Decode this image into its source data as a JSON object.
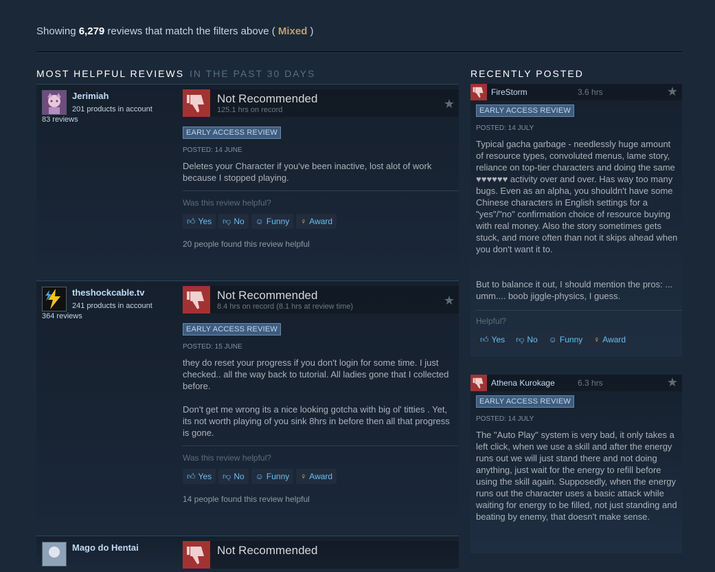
{
  "summary": {
    "prefix": "Showing ",
    "count": "6,279",
    "middle": " reviews that match the filters above ( ",
    "rating": "Mixed",
    "suffix": " )"
  },
  "sections": {
    "helpful_title": "MOST HELPFUL REVIEWS",
    "helpful_sub": "IN THE PAST 30 DAYS",
    "recent_title": "RECENTLY POSTED"
  },
  "colors": {
    "background": "#1b2838",
    "link": "#66c0f4",
    "mixed": "#b9a074",
    "thumb_down": "#a33233"
  },
  "helpful_reviews": [
    {
      "author": "Jerimiah",
      "products": "201 products in account",
      "reviews": "83 reviews",
      "verdict": "Not Recommended",
      "hours": "125.1 hrs on record",
      "badge": "EARLY ACCESS REVIEW",
      "posted": "POSTED: 14 JUNE",
      "text": "Deletes your Character if you've been inactive, lost alot of work because I stopped playing.",
      "helpful_q": "Was this review helpful?",
      "buttons": {
        "yes": "Yes",
        "no": "No",
        "funny": "Funny",
        "award": "Award"
      },
      "found": "20 people found this review helpful"
    },
    {
      "author": "theshockcable.tv",
      "products": "241 products in account",
      "reviews": "364 reviews",
      "verdict": "Not Recommended",
      "hours": "8.4 hrs on record (8.1 hrs at review time)",
      "badge": "EARLY ACCESS REVIEW",
      "posted": "POSTED: 15 JUNE",
      "text1": "they do reset your progress if you don't login for some time. I just checked.. all the way back to tutorial. All ladies gone that I collected before.",
      "text2": "Don't get me wrong its a nice looking gotcha with big ol' titties . Yet, its not worth playing of you sink 8hrs in before then all that progress is gone.",
      "helpful_q": "Was this review helpful?",
      "buttons": {
        "yes": "Yes",
        "no": "No",
        "funny": "Funny",
        "award": "Award"
      },
      "found": "14 people found this review helpful"
    },
    {
      "author": "Mago do Hentai",
      "verdict": "Not Recommended"
    }
  ],
  "recent_reviews": [
    {
      "author": "FireStorm",
      "hours": "3.6 hrs",
      "badge": "EARLY ACCESS REVIEW",
      "posted": "POSTED: 14 JULY",
      "text1": "Typical gacha garbage - needlessly huge amount of resource types, convoluted menus, lame story, reliance on top-tier characters and doing the same ♥♥♥♥♥♥ activity over and over. Has way too many bugs. Even as an alpha, you shouldn't have some Chinese characters in English settings for a \"yes\"/\"no\" confirmation choice of resource buying with real money. Also the story sometimes gets stuck, and more often than not it skips ahead when you don't want it to.",
      "text2": "But to balance it out, I should mention the pros: ... umm.... boob jiggle-physics, I guess.",
      "helpful_q": "Helpful?",
      "buttons": {
        "yes": "Yes",
        "no": "No",
        "funny": "Funny",
        "award": "Award"
      }
    },
    {
      "author": "Athena Kurokage",
      "hours": "6.3 hrs",
      "badge": "EARLY ACCESS REVIEW",
      "posted": "POSTED: 14 JULY",
      "text1": "The \"Auto Play\" system is very bad, it only takes a left click, when we use a skill and after the energy runs out we will just stand there and not doing anything, just wait for the energy to refill before using the skill again. Supposedly, when the energy runs out the character uses a basic attack while waiting for energy to be filled, not just standing and beating by enemy, that doesn't make sense."
    }
  ]
}
